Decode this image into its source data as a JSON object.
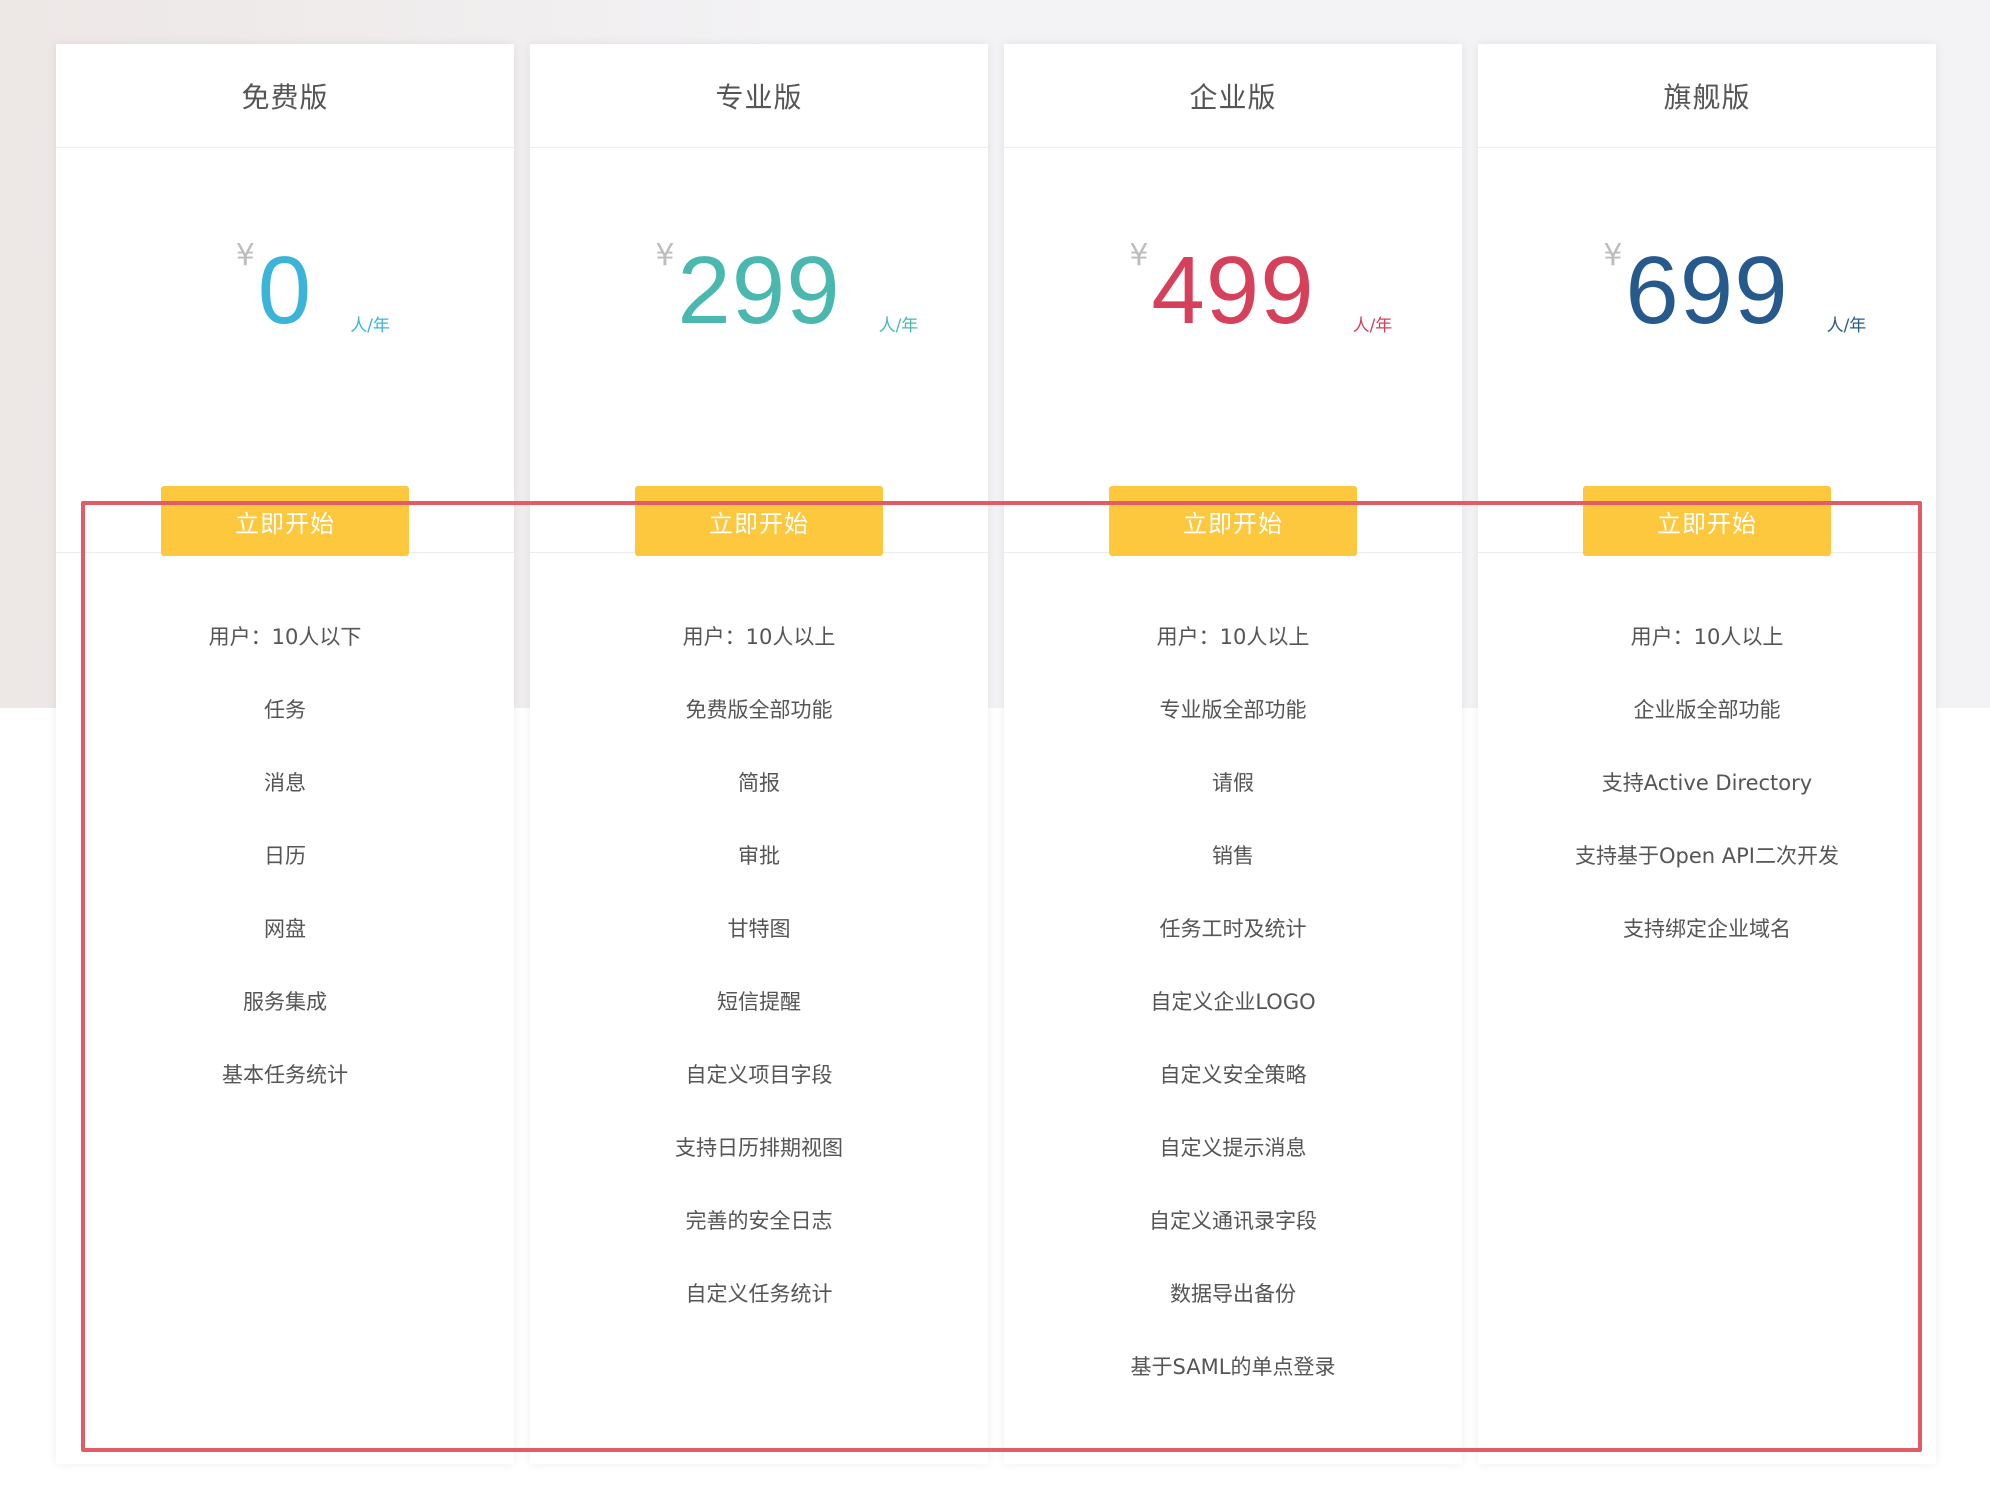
{
  "colors": {
    "button": "#fdc73e",
    "highlight_border": "#e25b67"
  },
  "plans": [
    {
      "name": "免费版",
      "currency": "¥",
      "price": "0",
      "unit": "人/年",
      "color": "#3bb4da",
      "cta": "立即开始",
      "features": [
        "用户：10人以下",
        "任务",
        "消息",
        "日历",
        "网盘",
        "服务集成",
        "基本任务统计"
      ]
    },
    {
      "name": "专业版",
      "currency": "¥",
      "price": "299",
      "unit": "人/年",
      "color": "#4bb8b0",
      "cta": "立即开始",
      "features": [
        "用户：10人以上",
        "免费版全部功能",
        "简报",
        "审批",
        "甘特图",
        "短信提醒",
        "自定义项目字段",
        "支持日历排期视图",
        "完善的安全日志",
        "自定义任务统计"
      ]
    },
    {
      "name": "企业版",
      "currency": "¥",
      "price": "499",
      "unit": "人/年",
      "color": "#d6405a",
      "cta": "立即开始",
      "features": [
        "用户：10人以上",
        "专业版全部功能",
        "请假",
        "销售",
        "任务工时及统计",
        "自定义企业LOGO",
        "自定义安全策略",
        "自定义提示消息",
        "自定义通讯录字段",
        "数据导出备份",
        "基于SAML的单点登录"
      ]
    },
    {
      "name": "旗舰版",
      "currency": "¥",
      "price": "699",
      "unit": "人/年",
      "color": "#275a8c",
      "cta": "立即开始",
      "features": [
        "用户：10人以上",
        "企业版全部功能",
        "支持Active Directory",
        "支持基于Open API二次开发",
        "支持绑定企业域名"
      ]
    }
  ]
}
